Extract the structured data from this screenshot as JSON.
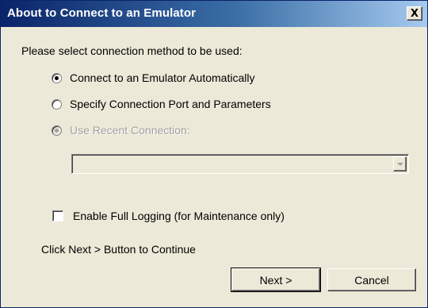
{
  "window": {
    "title": "About to Connect to an Emulator",
    "close_label": "X"
  },
  "prompt": "Please select connection method to be used:",
  "options": [
    {
      "label": "Connect to an Emulator Automatically",
      "selected": true,
      "enabled": true
    },
    {
      "label": "Specify Connection Port and Parameters",
      "selected": false,
      "enabled": true
    },
    {
      "label": "Use Recent Connection:",
      "selected": true,
      "enabled": false
    }
  ],
  "recent_connection": {
    "value": "",
    "enabled": false
  },
  "logging": {
    "label": "Enable Full Logging (for Maintenance only)",
    "checked": false
  },
  "hint": "Click Next > Button to Continue",
  "buttons": {
    "next": "Next >",
    "cancel": "Cancel"
  }
}
